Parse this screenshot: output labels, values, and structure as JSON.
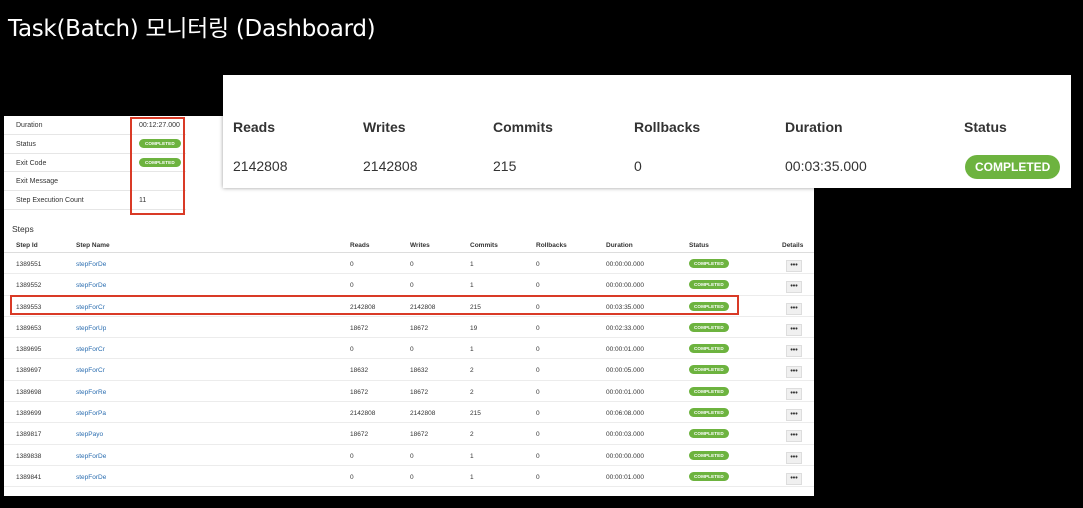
{
  "title": "Task(Batch) 모니터링 (Dashboard)",
  "summary": {
    "rows": [
      {
        "label": "Duration",
        "value": "00:12:27.000"
      },
      {
        "label": "Status",
        "badge": "COMPLETED"
      },
      {
        "label": "Exit Code",
        "badge": "COMPLETED"
      },
      {
        "label": "Exit Message",
        "value": ""
      },
      {
        "label": "Step Execution Count",
        "value": "11"
      }
    ]
  },
  "steps": {
    "heading": "Steps",
    "columns": [
      "Step Id",
      "Step Name",
      "Reads",
      "Writes",
      "Commits",
      "Rollbacks",
      "Duration",
      "Status",
      "Details"
    ],
    "details_button": "•••",
    "rows": [
      {
        "id": "1389551",
        "name": "stepForDe",
        "reads": "0",
        "writes": "0",
        "commits": "1",
        "rollbacks": "0",
        "duration": "00:00:00.000",
        "status": "COMPLETED"
      },
      {
        "id": "1389552",
        "name": "stepForDe",
        "reads": "0",
        "writes": "0",
        "commits": "1",
        "rollbacks": "0",
        "duration": "00:00:00.000",
        "status": "COMPLETED"
      },
      {
        "id": "1389553",
        "name": "stepForCr",
        "reads": "2142808",
        "writes": "2142808",
        "commits": "215",
        "rollbacks": "0",
        "duration": "00:03:35.000",
        "status": "COMPLETED"
      },
      {
        "id": "1389653",
        "name": "stepForUp",
        "reads": "18672",
        "writes": "18672",
        "commits": "19",
        "rollbacks": "0",
        "duration": "00:02:33.000",
        "status": "COMPLETED"
      },
      {
        "id": "1389695",
        "name": "stepForCr",
        "reads": "0",
        "writes": "0",
        "commits": "1",
        "rollbacks": "0",
        "duration": "00:00:01.000",
        "status": "COMPLETED"
      },
      {
        "id": "1389697",
        "name": "stepForCr",
        "reads": "18632",
        "writes": "18632",
        "commits": "2",
        "rollbacks": "0",
        "duration": "00:00:05.000",
        "status": "COMPLETED"
      },
      {
        "id": "1389698",
        "name": "stepForRe",
        "reads": "18672",
        "writes": "18672",
        "commits": "2",
        "rollbacks": "0",
        "duration": "00:00:01.000",
        "status": "COMPLETED"
      },
      {
        "id": "1389699",
        "name": "stepForPa",
        "reads": "2142808",
        "writes": "2142808",
        "commits": "215",
        "rollbacks": "0",
        "duration": "00:06:08.000",
        "status": "COMPLETED"
      },
      {
        "id": "1389817",
        "name": "stepPayo",
        "reads": "18672",
        "writes": "18672",
        "commits": "2",
        "rollbacks": "0",
        "duration": "00:00:03.000",
        "status": "COMPLETED"
      },
      {
        "id": "1389838",
        "name": "stepForDe",
        "reads": "0",
        "writes": "0",
        "commits": "1",
        "rollbacks": "0",
        "duration": "00:00:00.000",
        "status": "COMPLETED"
      },
      {
        "id": "1389841",
        "name": "stepForDe",
        "reads": "0",
        "writes": "0",
        "commits": "1",
        "rollbacks": "0",
        "duration": "00:00:01.000",
        "status": "COMPLETED"
      }
    ]
  },
  "zoom": {
    "headers": [
      "Reads",
      "Writes",
      "Commits",
      "Rollbacks",
      "Duration",
      "Status"
    ],
    "values": [
      "2142808",
      "2142808",
      "215",
      "0",
      "00:03:35.000"
    ],
    "status": "COMPLETED"
  },
  "colors": {
    "badge_green": "#6db33f",
    "highlight_red": "#d93a26",
    "link_blue": "#2a6db0"
  }
}
